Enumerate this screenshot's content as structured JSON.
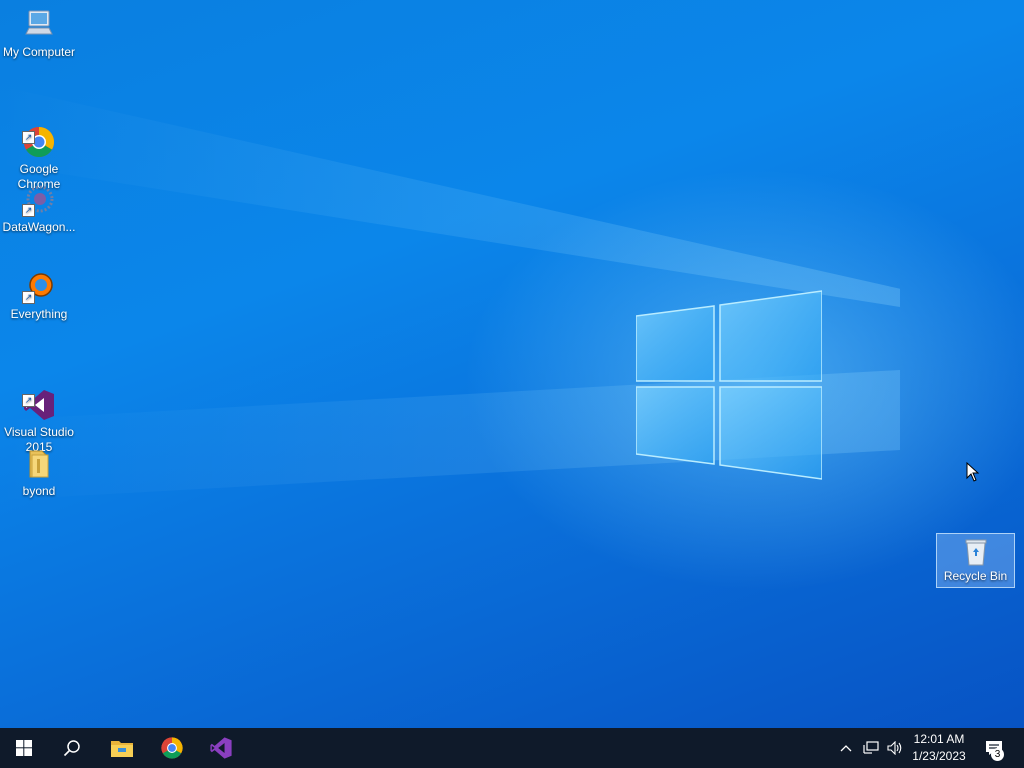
{
  "desktop": {
    "icons": [
      {
        "label": "My Computer",
        "icon": "computer-icon"
      },
      {
        "label": "Google\nChrome",
        "icon": "chrome-icon"
      },
      {
        "label": "DataWagon...",
        "icon": "datawagon-icon"
      },
      {
        "label": "Everything",
        "icon": "everything-icon"
      },
      {
        "label": "Visual Studio\n2015",
        "icon": "visual-studio-icon"
      },
      {
        "label": "byond",
        "icon": "folder-icon"
      }
    ],
    "recycle_bin": {
      "label": "Recycle Bin",
      "icon": "recycle-bin-icon"
    }
  },
  "taskbar": {
    "start": {
      "icon": "windows-start-icon"
    },
    "search": {
      "icon": "search-icon"
    },
    "pinned": [
      {
        "name": "File Explorer",
        "icon": "file-explorer-icon"
      },
      {
        "name": "Google Chrome",
        "icon": "chrome-icon"
      },
      {
        "name": "Visual Studio",
        "icon": "visual-studio-icon"
      }
    ],
    "tray": {
      "chevron_icon": "chevron-up-icon",
      "network_icon": "network-icon",
      "volume_icon": "volume-icon",
      "time": "12:01 AM",
      "date": "1/23/2023",
      "notification_count": "3"
    }
  },
  "colors": {
    "desktop_blue": "#0a7fe0",
    "taskbar": "#0f1a2a",
    "vs_purple": "#68217a"
  }
}
